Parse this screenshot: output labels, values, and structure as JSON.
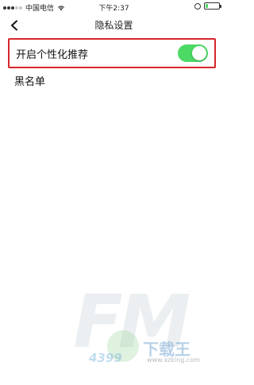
{
  "status_bar": {
    "carrier": "中国电信",
    "time": "下午2:37"
  },
  "nav": {
    "title": "隐私设置",
    "back_icon": "chevron-left-icon"
  },
  "settings": {
    "personalized": {
      "label": "开启个性化推荐",
      "enabled": true
    },
    "blacklist": {
      "label": "黑名单"
    }
  },
  "watermark": {
    "big_text": "FM",
    "small_text": "4399",
    "brand": "下载王",
    "url": "www.xzking.com"
  },
  "colors": {
    "accent_green": "#4cd964",
    "highlight_red": "#d6262b"
  }
}
